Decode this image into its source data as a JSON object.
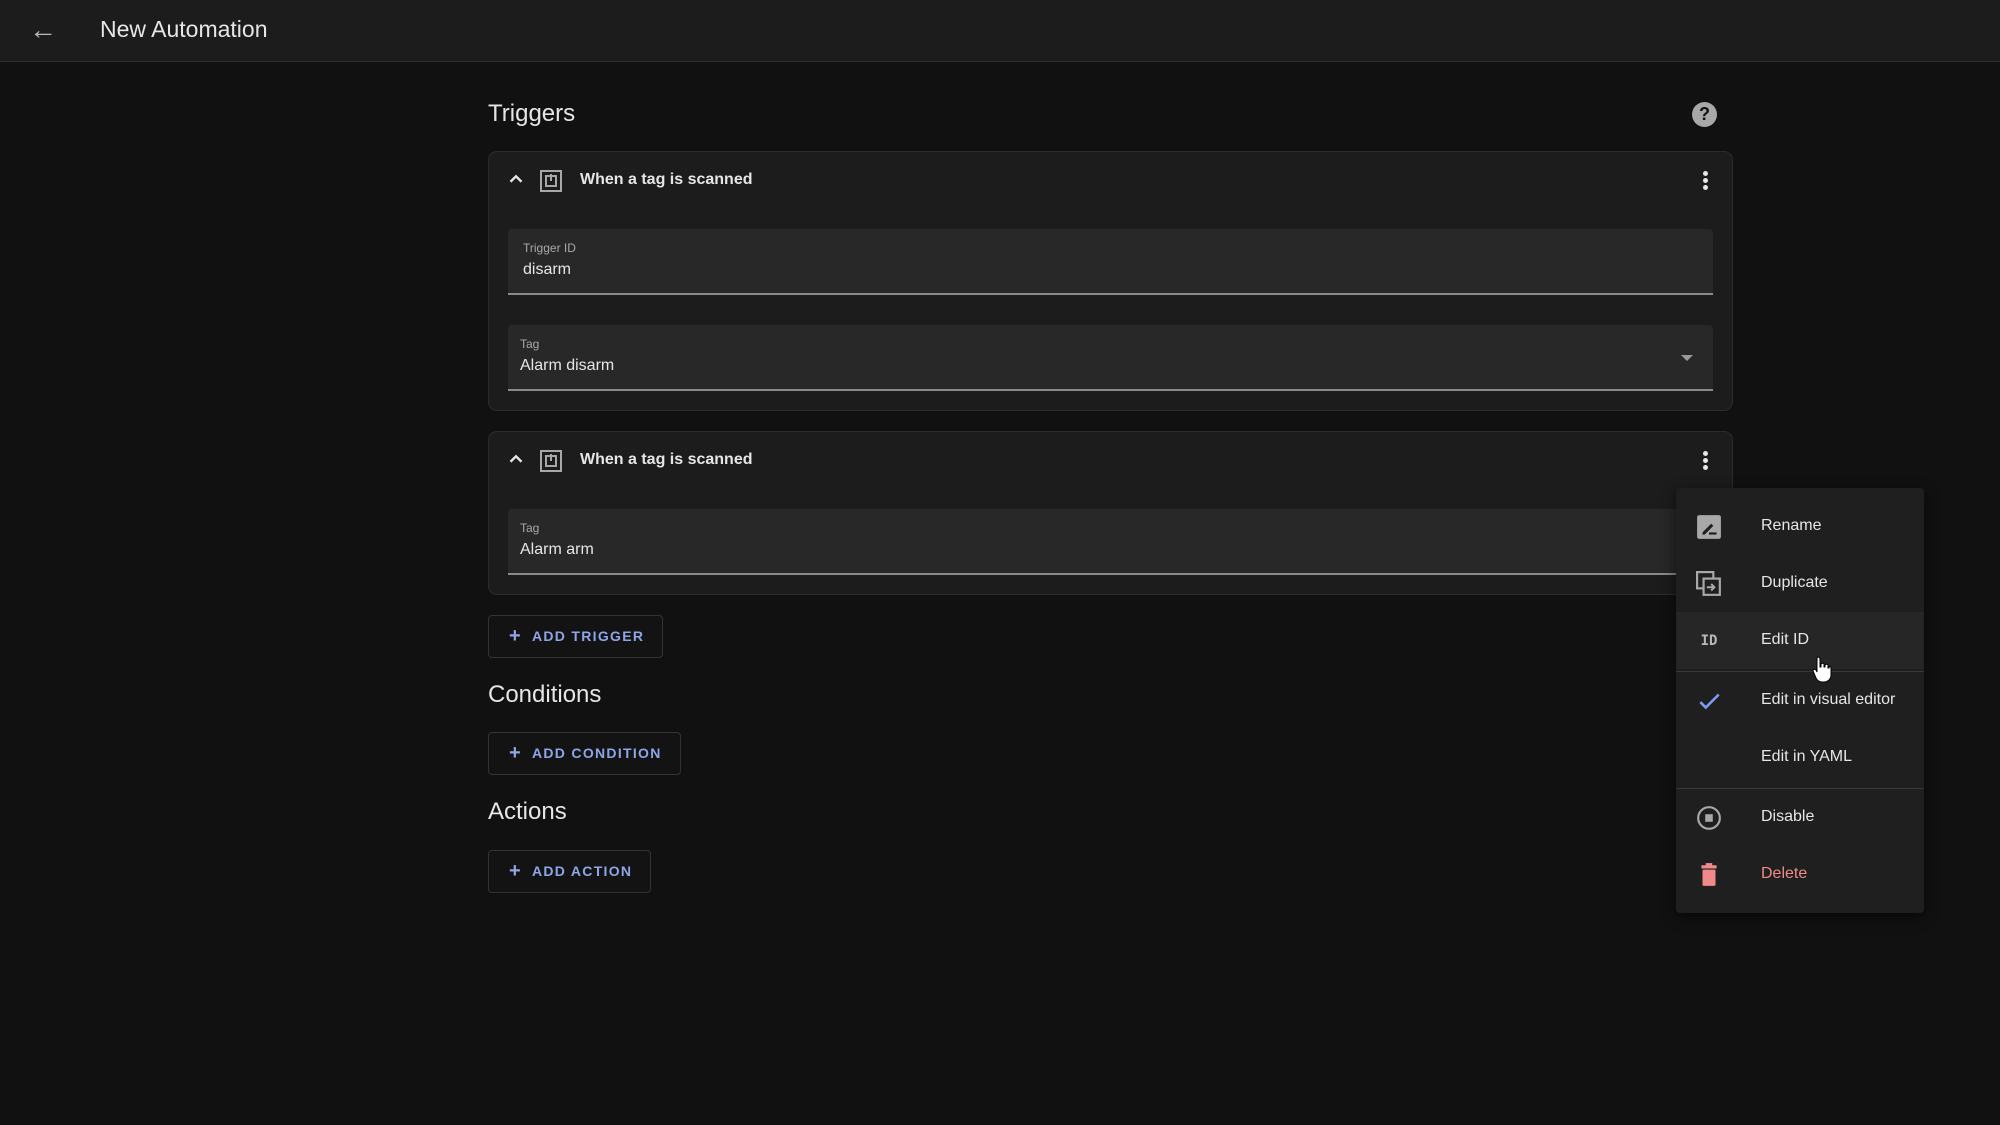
{
  "header": {
    "title": "New Automation",
    "back_icon": "arrow-left-icon"
  },
  "sections": {
    "triggers": "Triggers",
    "conditions": "Conditions",
    "actions": "Actions"
  },
  "help_icon": "help-circle-icon",
  "triggers": [
    {
      "title": "When a tag is scanned",
      "fields": [
        {
          "label": "Trigger ID",
          "value": "disarm"
        },
        {
          "label": "Tag",
          "value": "Alarm disarm",
          "dropdown": true
        }
      ]
    },
    {
      "title": "When a tag is scanned",
      "fields": [
        {
          "label": "Tag",
          "value": "Alarm arm"
        }
      ]
    }
  ],
  "buttons": {
    "add_trigger": "ADD TRIGGER",
    "add_condition": "ADD CONDITION",
    "add_action": "ADD ACTION"
  },
  "menu": {
    "items": [
      {
        "label": "Rename",
        "icon": "rename-icon"
      },
      {
        "label": "Duplicate",
        "icon": "duplicate-icon"
      },
      {
        "label": "Edit ID",
        "icon": "id-icon",
        "highlighted": true
      },
      {
        "label": "Edit in visual editor",
        "icon": "check-icon",
        "checked": true
      },
      {
        "label": "Edit in YAML",
        "icon": ""
      },
      {
        "label": "Disable",
        "icon": "disable-icon"
      },
      {
        "label": "Delete",
        "icon": "delete-icon",
        "color": "#f08a8a"
      }
    ]
  },
  "colors": {
    "accent": "#8ea6e8",
    "delete": "#f08a8a",
    "check": "#7b9cf0"
  }
}
